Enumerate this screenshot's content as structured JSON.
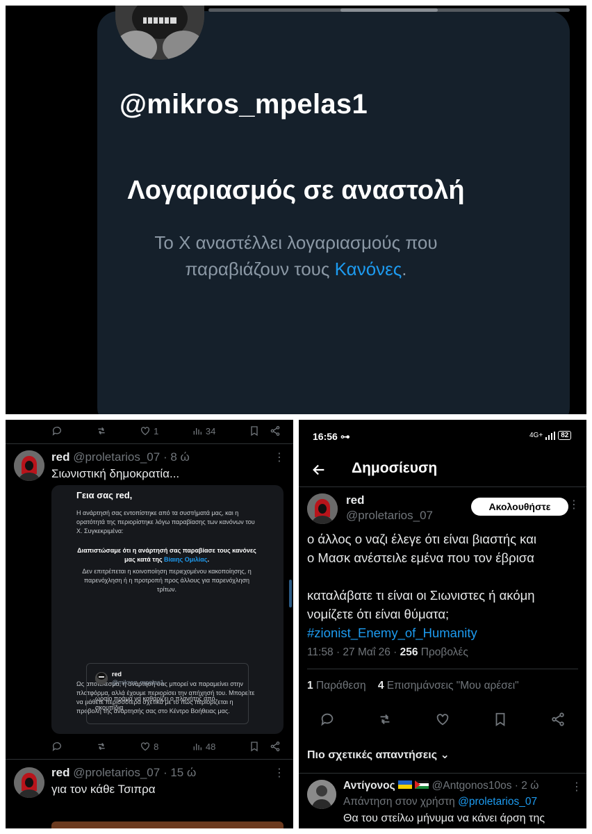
{
  "suspended_screen": {
    "handle": "@mikros_mpelas1",
    "title": "Λογαριασμός σε αναστολή",
    "subtitle_line1": "Το X αναστέλλει λογαριασμούς που",
    "subtitle_line2_prefix": "παραβιάζουν τους ",
    "rules_link": "Κανόνες",
    "subtitle_suffix": "."
  },
  "feed": {
    "top_actions": {
      "likes": "1",
      "views": "34"
    },
    "tweet1": {
      "name": "red",
      "handle": "@proletarios_07",
      "time": "· 8 ώ",
      "text": "Σιωνιστική δημοκρατία...",
      "notice": {
        "greeting": "Γεια σας red,",
        "para1": "Η ανάρτησή σας εντοπίστηκε από τα συστήματά μας, και η ορατότητά της περιορίστηκε λόγω παραβίασης των κανόνων του X. Συγκεκριμένα:",
        "bold_prefix": "Διαπιστώσαμε ότι η ανάρτησή σας παραβίασε τους κανόνες μας κατά της ",
        "bold_link": "Βίαιης Ομιλίας",
        "bold_suffix": ".",
        "para2": "Δεν επιτρέπεται η κοινοποίηση περιεχομένου κακοποίησης, η παρενόχληση ή η προτροπή προς άλλους για παρενόχληση τρίτων.",
        "quote_name": "red",
        "quote_handle": "@mikros_mpelas1",
        "quote_text": "ωραίο πράμα να καθαρίζει ο πλανήτης από σκουπίδια",
        "para3": "Ως αποτέλεσμα, η ανάρτησή σας μπορεί να παραμείνει στην πλατφόρμα, αλλά έχουμε περιορίσει την απήχησή του. Μπορείτε να μάθετε περισσότερα σχετικά με το πώς περιορίζεται η προβολή της ανάρτησής σας στο Κέντρο Βοήθειας μας."
      },
      "actions": {
        "likes": "8",
        "views": "48"
      }
    },
    "tweet2": {
      "name": "red",
      "handle": "@proletarios_07",
      "time": "· 15 ώ",
      "text": "για τον κάθε Τσιπρα"
    }
  },
  "post_view": {
    "status_bar": {
      "time": "16:56",
      "network": "4G+",
      "battery": "82"
    },
    "header_title": "Δημοσίευση",
    "author": {
      "name": "red",
      "handle": "@proletarios_07"
    },
    "follow_label": "Ακολουθήστε",
    "body_line1": "ο άλλος ο ναζι έλεγε ότι είναι βιαστής και",
    "body_line2": "ο Μασκ ανέστειλε εμένα που τον έβρισα",
    "body_line3": "καταλάβατε τι είναι οι Σιωνιστες ή ακόμη",
    "body_line4": "νομίζετε ότι είναι θύματα;",
    "hashtag": "#zionist_Enemy_of_Humanity",
    "meta_time": "11:58 · 27 Μαΐ 26 · ",
    "views_count": "256",
    "views_label": " Προβολές",
    "quotes_count": "1",
    "quotes_label": " Παράθεση",
    "likes_count": "4",
    "likes_label": " Επισημάνσεις \"Μου αρέσει\"",
    "replies_sort": "Πιο σχετικές απαντήσεις",
    "reply": {
      "name": "Αντίγονος",
      "handle": "@Antgonos10os",
      "time": "· 2 ώ",
      "reply_to_prefix": "Απάντηση στον χρήστη ",
      "reply_to_handle": "@proletarios_07",
      "text": "Θα του στείλω μήνυμα να κάνει άρση της"
    }
  },
  "colors": {
    "accent": "#1d9bf0",
    "card_bg": "#15202b",
    "muted": "#71767b"
  }
}
